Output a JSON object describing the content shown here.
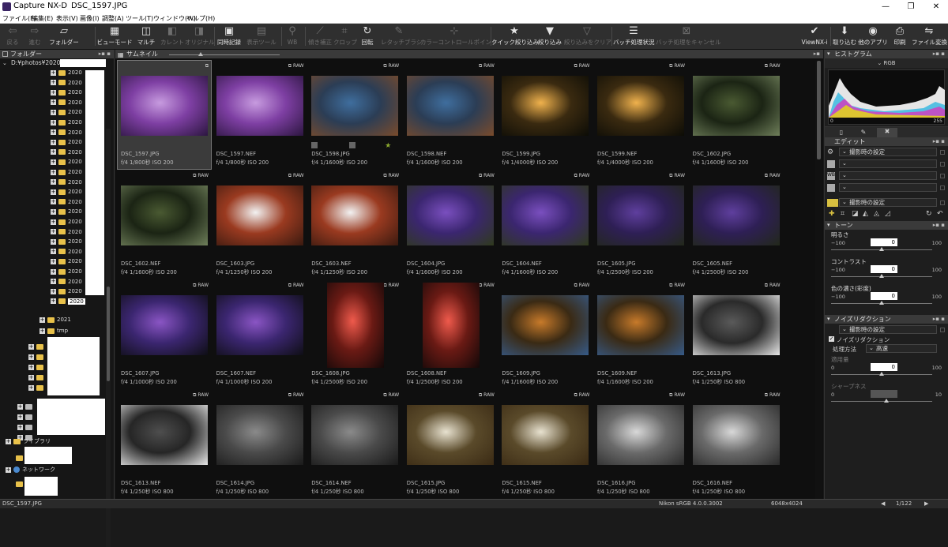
{
  "window": {
    "app_title": "Capture NX-D",
    "doc_title": "DSC_1597.JPG",
    "minimize": "—",
    "restore": "❐",
    "close": "✕"
  },
  "menu": [
    "ファイル(F)",
    "編集(E)",
    "表示(V)",
    "画像(I)",
    "調整(A)",
    "ツール(T)",
    "ウィンドウ(W)",
    "ヘルプ(H)"
  ],
  "toolbar": [
    {
      "label": "戻る",
      "glyph": "⇦",
      "state": "dim"
    },
    {
      "label": "進む",
      "glyph": "⇨",
      "state": "dim"
    },
    {
      "label": "フォルダー",
      "glyph": "▱",
      "state": "bright"
    },
    {
      "label": "ビューモード",
      "glyph": "▦",
      "state": "bright"
    },
    {
      "label": "マルチ",
      "glyph": "◫",
      "state": "bright"
    },
    {
      "label": "カレント",
      "glyph": "◧",
      "state": "dim"
    },
    {
      "label": "オリジナル",
      "glyph": "◨",
      "state": "dim"
    },
    {
      "label": "同時記録",
      "glyph": "▣",
      "state": "bright"
    },
    {
      "label": "表示ツール",
      "glyph": "▤",
      "state": "dim"
    },
    {
      "label": "WB",
      "glyph": "⚲",
      "state": "dim"
    },
    {
      "label": "傾き補正",
      "glyph": "⟋",
      "state": "dim"
    },
    {
      "label": "クロップ",
      "glyph": "⌗",
      "state": "dim"
    },
    {
      "label": "回転",
      "glyph": "↻",
      "state": "bright"
    },
    {
      "label": "レタッチブラシ",
      "glyph": "✎",
      "state": "dim"
    },
    {
      "label": "カラーコントロールポイント",
      "glyph": "⊹",
      "state": "dim"
    },
    {
      "label": "クイック絞り込み",
      "glyph": "★",
      "state": "bright"
    },
    {
      "label": "絞り込み",
      "glyph": "▼",
      "state": "bright"
    },
    {
      "label": "絞り込みをクリア",
      "glyph": "▽",
      "state": "dim"
    },
    {
      "label": "バッチ処理状況",
      "glyph": "☰",
      "state": "bright"
    },
    {
      "label": "バッチ処理をキャンセル",
      "glyph": "⊠",
      "state": "dim"
    },
    {
      "label": "ViewNX-i",
      "glyph": "✔",
      "state": "bright"
    },
    {
      "label": "取り込む",
      "glyph": "⬇",
      "state": "bright"
    },
    {
      "label": "他のアプリ",
      "glyph": "◉",
      "state": "bright"
    },
    {
      "label": "印刷",
      "glyph": "⎙",
      "state": "bright"
    },
    {
      "label": "ファイル変換",
      "glyph": "⇋",
      "state": "bright"
    }
  ],
  "left_panel": {
    "title": "フォルダー",
    "path": "D:¥photos¥2020¥2",
    "folder_label": "2020",
    "selected_folder": "2020",
    "folder_2021": "2021",
    "folder_tmp": "tmp",
    "library": "ライブラリ",
    "network": "ネットワーク"
  },
  "center": {
    "title": "サムネイル",
    "panel_ctl": "▸▪"
  },
  "thumbnails": [
    {
      "name": "DSC_1597.JPG",
      "info": "f/4 1/800秒 ISO 200",
      "badge": "⧉",
      "colors": [
        "#c79bdf",
        "#7e3fa3",
        "#2c1640"
      ],
      "selected": true
    },
    {
      "name": "DSC_1597.NEF",
      "info": "f/4 1/800秒 ISO 200",
      "badge": "⧉ RAW",
      "colors": [
        "#c79bdf",
        "#7e3fa3",
        "#2c1640"
      ]
    },
    {
      "name": "DSC_1598.JPG",
      "info": "f/4 1/1600秒 ISO 200",
      "badge": "⧉ RAW",
      "colors": [
        "#3f6e9e",
        "#2b3d55",
        "#7a4b2b"
      ],
      "star": true
    },
    {
      "name": "DSC_1598.NEF",
      "info": "f/4 1/1600秒 ISO 200",
      "badge": "⧉ RAW",
      "colors": [
        "#3f6e9e",
        "#2b3d55",
        "#7a4b2b"
      ]
    },
    {
      "name": "DSC_1599.JPG",
      "info": "f/4 1/4000秒 ISO 200",
      "badge": "⧉ RAW",
      "colors": [
        "#f0b24d",
        "#3a2a10",
        "#0c0c06"
      ]
    },
    {
      "name": "DSC_1599.NEF",
      "info": "f/4 1/4000秒 ISO 200",
      "badge": "⧉ RAW",
      "colors": [
        "#f0b24d",
        "#3a2a10",
        "#0c0c06"
      ]
    },
    {
      "name": "DSC_1602.JPG",
      "info": "f/4 1/1600秒 ISO 200",
      "badge": "⧉ RAW",
      "colors": [
        "#4a5a32",
        "#1b2414",
        "#6f7f5a"
      ]
    },
    {
      "name": "DSC_1602.NEF",
      "info": "f/4 1/1600秒 ISO 200",
      "badge": "⧉ RAW",
      "colors": [
        "#4a5a32",
        "#1b2414",
        "#6f7f5a"
      ]
    },
    {
      "name": "DSC_1603.JPG",
      "info": "f/4 1/1250秒 ISO 200",
      "badge": "⧉ RAW",
      "colors": [
        "#f2f2f2",
        "#9a3a20",
        "#3a1a10"
      ]
    },
    {
      "name": "DSC_1603.NEF",
      "info": "f/4 1/1250秒 ISO 200",
      "badge": "⧉ RAW",
      "colors": [
        "#f2f2f2",
        "#9a3a20",
        "#3a1a10"
      ]
    },
    {
      "name": "DSC_1604.JPG",
      "info": "f/4 1/1600秒 ISO 200",
      "badge": "⧉ RAW",
      "colors": [
        "#7a4fbf",
        "#3b2670",
        "#2f3a1c"
      ]
    },
    {
      "name": "DSC_1604.NEF",
      "info": "f/4 1/1600秒 ISO 200",
      "badge": "⧉ RAW",
      "colors": [
        "#7a4fbf",
        "#3b2670",
        "#2f3a1c"
      ]
    },
    {
      "name": "DSC_1605.JPG",
      "info": "f/4 1/2500秒 ISO 200",
      "badge": "⧉ RAW",
      "colors": [
        "#5f3f9e",
        "#2e1f55",
        "#22281a"
      ]
    },
    {
      "name": "DSC_1605.NEF",
      "info": "f/4 1/2500秒 ISO 200",
      "badge": "⧉ RAW",
      "colors": [
        "#5f3f9e",
        "#2e1f55",
        "#22281a"
      ]
    },
    {
      "name": "DSC_1607.JPG",
      "info": "f/4 1/1000秒 ISO 200",
      "badge": "⧉ RAW",
      "colors": [
        "#8a55c4",
        "#3b2670",
        "#0e0e14"
      ]
    },
    {
      "name": "DSC_1607.NEF",
      "info": "f/4 1/1000秒 ISO 200",
      "badge": "⧉ RAW",
      "colors": [
        "#8a55c4",
        "#3b2670",
        "#0e0e14"
      ]
    },
    {
      "name": "DSC_1608.JPG",
      "info": "f/4 1/2500秒 ISO 200",
      "badge": "⧉ RAW",
      "colors": [
        "#ef5a4c",
        "#6a1a14",
        "#120808"
      ],
      "tall": true
    },
    {
      "name": "DSC_1608.NEF",
      "info": "f/4 1/2500秒 ISO 200",
      "badge": "⧉ RAW",
      "colors": [
        "#ef5a4c",
        "#6a1a14",
        "#120808"
      ],
      "tall": true
    },
    {
      "name": "DSC_1609.JPG",
      "info": "f/4 1/1600秒 ISO 200",
      "badge": "⧉ RAW",
      "colors": [
        "#c77a2a",
        "#3a2a14",
        "#365a88"
      ]
    },
    {
      "name": "DSC_1609.NEF",
      "info": "f/4 1/1600秒 ISO 200",
      "badge": "⧉ RAW",
      "colors": [
        "#c77a2a",
        "#3a2a14",
        "#365a88"
      ]
    },
    {
      "name": "DSC_1613.JPG",
      "info": "f/4 1/250秒 ISO 800",
      "badge": "⧉ RAW",
      "colors": [
        "#5a5a5a",
        "#2a2a2a",
        "#e8e8e8"
      ]
    },
    {
      "name": "DSC_1613.NEF",
      "info": "f/4 1/250秒 ISO 800",
      "badge": "⧉ RAW",
      "colors": [
        "#4e4e4e",
        "#262626",
        "#e8e8e8"
      ]
    },
    {
      "name": "DSC_1614.JPG",
      "info": "f/4 1/250秒 ISO 800",
      "badge": "⧉ RAW",
      "colors": [
        "#8a8a8a",
        "#4a4a4a",
        "#1a1a1a"
      ]
    },
    {
      "name": "DSC_1614.NEF",
      "info": "f/4 1/250秒 ISO 800",
      "badge": "⧉ RAW",
      "colors": [
        "#8a8a8a",
        "#4a4a4a",
        "#1a1a1a"
      ]
    },
    {
      "name": "DSC_1615.JPG",
      "info": "f/4 1/250秒 ISO 800",
      "badge": "⧉ RAW",
      "colors": [
        "#e8e2d0",
        "#5a4a2a",
        "#3a2a14"
      ]
    },
    {
      "name": "DSC_1615.NEF",
      "info": "f/4 1/250秒 ISO 800",
      "badge": "⧉ RAW",
      "colors": [
        "#e8e2d0",
        "#5a4a2a",
        "#3a2a14"
      ]
    },
    {
      "name": "DSC_1616.JPG",
      "info": "f/4 1/250秒 ISO 800",
      "badge": "⧉ RAW",
      "colors": [
        "#d8d8d8",
        "#6a6a6a",
        "#2a2a2a"
      ]
    },
    {
      "name": "DSC_1616.NEF",
      "info": "f/4 1/250秒 ISO 800",
      "badge": "⧉ RAW",
      "colors": [
        "#d8d8d8",
        "#6a6a6a",
        "#2a2a2a"
      ]
    }
  ],
  "right_panel": {
    "histogram": {
      "title": "ヒストグラム",
      "channel": "RGB",
      "min": "0",
      "max": "255"
    },
    "edit": {
      "title": "エディット",
      "preset": "撮影時の設定",
      "preset_bottom": "撮影時の設定"
    },
    "tone": {
      "title": "トーン",
      "sliders": [
        {
          "label": "明るさ",
          "min": "−100",
          "max": "100",
          "value": "0",
          "pos": 0.5
        },
        {
          "label": "コントラスト",
          "min": "−100",
          "max": "100",
          "value": "0",
          "pos": 0.5
        },
        {
          "label": "色の濃さ(彩度)",
          "min": "−100",
          "max": "100",
          "value": "0",
          "pos": 0.5
        }
      ]
    },
    "nr": {
      "title": "ノイズリダクション",
      "preset": "撮影時の設定",
      "checkbox_label": "ノイズリダクション",
      "method_label": "処理方法",
      "method_value": "高速",
      "sliders": [
        {
          "label": "適用量",
          "min": "0",
          "max": "100",
          "value": "0",
          "pos": 0.5
        },
        {
          "label": "シャープネス",
          "min": "0",
          "max": "10",
          "value": "",
          "pos": 0.55
        }
      ]
    }
  },
  "status": {
    "file": "DSC_1597.JPG",
    "profile": "Nikon sRGB 4.0.0.3002",
    "dims": "6048x4024",
    "page": "1/122"
  }
}
